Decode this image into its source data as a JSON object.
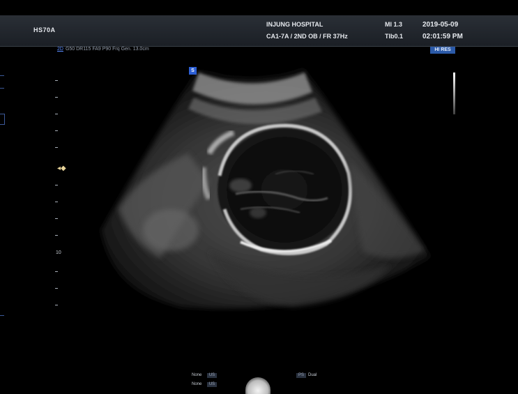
{
  "header": {
    "model": "HS70A",
    "hospital": "INJUNG HOSPITAL",
    "probe_preset": "CA1-7A / 2ND OB / FR 37Hz",
    "mi": "MI  1.3",
    "tib": "TIb0.1",
    "date": "2019-05-09",
    "time": "02:01:59 PM"
  },
  "image_params": {
    "mode": "2D",
    "text": "G50 DR115 FA9 P90 Frq Gen. 13.0cm"
  },
  "orientation_marker": "S",
  "hi_tag": "HI RES",
  "depth_scale": {
    "label": "10",
    "focus_symbol": "◂◆"
  },
  "bottom_panel": {
    "row1_label": "None",
    "row1_box": "US",
    "row1_right_box": "PS",
    "row1_right_text": "Dual",
    "row2_label": "None",
    "row2_box": "US"
  },
  "colors": {
    "accent": "#2d5fd4",
    "header_bg": "#1f242b",
    "param_text": "#9aa4b4"
  }
}
